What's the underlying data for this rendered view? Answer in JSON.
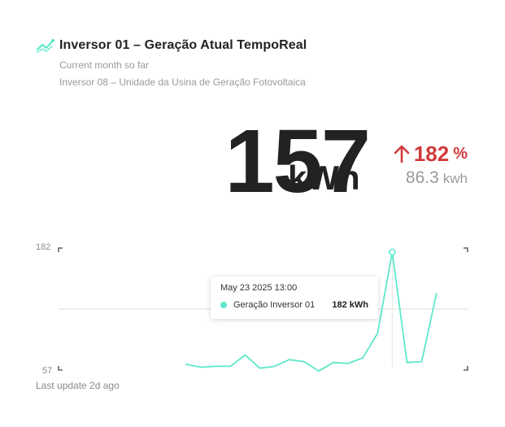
{
  "header": {
    "title": "Inversor 01 – Geração Atual TempoReal",
    "subtitle1": "Current month so far",
    "subtitle2": "Inversor 08 – Unidade da Usina de Geração Fotovoltaica",
    "icon": "trend-line-icon"
  },
  "metric": {
    "value": "157",
    "unit": "kWh",
    "delta_value": "182",
    "delta_unit": "%",
    "delta_direction": "up",
    "compare_value": "86.3",
    "compare_unit": "kwh"
  },
  "colors": {
    "accent": "#5ee8c9",
    "delta": "#d23a3a",
    "muted": "#9a9a9a"
  },
  "chart_data": {
    "type": "line",
    "y_axis_labels": {
      "max": "182",
      "min": "57"
    },
    "ylim": [
      57,
      182
    ],
    "series": [
      {
        "name": "Geração Inversor 01",
        "values": [
          63,
          60,
          61,
          61,
          73,
          59,
          61,
          68,
          66,
          56,
          65,
          64,
          70,
          96,
          182,
          65,
          66,
          138
        ]
      }
    ],
    "highlight_index": 14,
    "grid": "single horizontal midline"
  },
  "tooltip": {
    "date": "May 23 2025 13:00",
    "series": "Geração Inversor 01",
    "value": "182 kWh"
  },
  "footer": {
    "last_update": "Last update 2d ago"
  }
}
